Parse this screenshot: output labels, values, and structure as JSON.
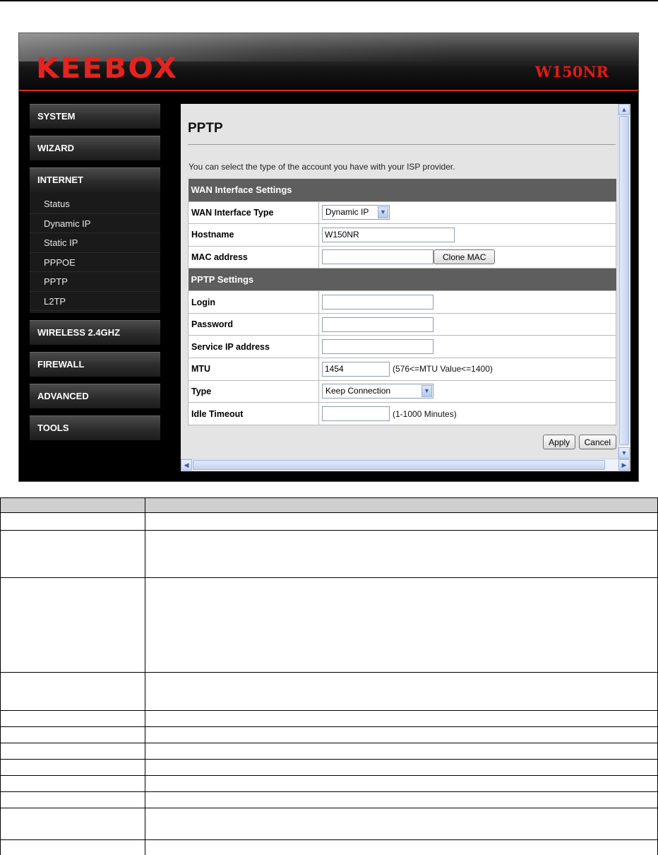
{
  "header": {
    "brand": "KEEBOX",
    "model": "W150NR"
  },
  "sidebar": {
    "menus": [
      {
        "label": "SYSTEM"
      },
      {
        "label": "WIZARD"
      },
      {
        "label": "INTERNET",
        "items": [
          "Status",
          "Dynamic IP",
          "Static IP",
          "PPPOE",
          "PPTP",
          "L2TP"
        ]
      },
      {
        "label": "WIRELESS 2.4GHZ"
      },
      {
        "label": "FIREWALL"
      },
      {
        "label": "ADVANCED"
      },
      {
        "label": "TOOLS"
      }
    ]
  },
  "page": {
    "title": "PPTP",
    "intro": "You can select the type of the account you have with your ISP provider."
  },
  "wan": {
    "section": "WAN Interface Settings",
    "type_label": "WAN Interface Type",
    "type_value": "Dynamic IP",
    "hostname_label": "Hostname",
    "hostname_value": "W150NR",
    "mac_label": "MAC address",
    "mac_value": "",
    "clone_mac": "Clone MAC"
  },
  "pptp": {
    "section": "PPTP Settings",
    "login_label": "Login",
    "login_value": "",
    "password_label": "Password",
    "password_value": "",
    "service_ip_label": "Service IP address",
    "service_ip_value": "",
    "mtu_label": "MTU",
    "mtu_value": "1454",
    "mtu_hint": "(576<=MTU Value<=1400)",
    "type_label": "Type",
    "type_value": "Keep Connection",
    "idle_label": "Idle Timeout",
    "idle_value": "",
    "idle_hint": "(1-1000 Minutes)"
  },
  "actions": {
    "apply": "Apply",
    "cancel": "Cancel"
  },
  "colors": {
    "accent_red": "#e6231f",
    "section_header": "#5e5e5e"
  }
}
